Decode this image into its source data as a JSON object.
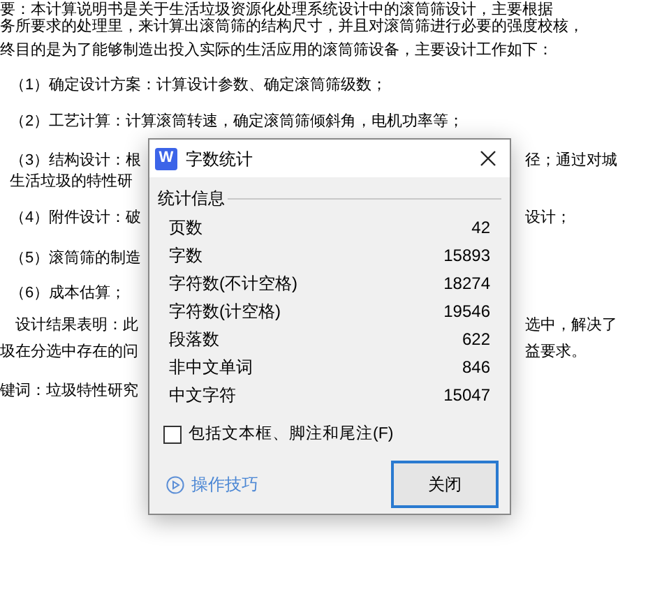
{
  "document": {
    "lines": [
      {
        "text": "要：本计算说明书是关于生活垃圾资源化处理系统设计中的滚筒筛设计，主要根据"
      },
      {
        "text": "务所要求的处理里，来计算出滚筒筛的结构尺寸，并且对滚筒筛进行必要的强度校核，"
      },
      {
        "text": "终目的是为了能够制造出投入实际的生活应用的滚筒筛设备，主要设计工作如下："
      },
      {
        "text": "（1）确定设计方案：计算设计参数、确定滚筒筛级数；"
      },
      {
        "text": "（2）工艺计算：计算滚筒转速，确定滚筒筛倾斜角，电机功率等；"
      },
      {
        "text": "（3）结构设计：根",
        "right": "径；通过对城"
      },
      {
        "text": "生活垃圾的特性研"
      },
      {
        "text": "（4）附件设计：破",
        "right": "设计；"
      },
      {
        "text": "（5）滚筒筛的制造"
      },
      {
        "text": "（6）成本估算；"
      },
      {
        "text": "设计结果表明：此",
        "right": "选中，解决了"
      },
      {
        "text": "圾在分选中存在的问",
        "right": "益要求。"
      },
      {
        "text": "键词：垃圾特性研究"
      }
    ]
  },
  "dialog": {
    "app_icon": "W",
    "title": "字数统计",
    "section": "统计信息",
    "stats": [
      {
        "label": "页数",
        "value": "42"
      },
      {
        "label": "字数",
        "value": "15893"
      },
      {
        "label": "字符数(不计空格)",
        "value": "18274"
      },
      {
        "label": "字符数(计空格)",
        "value": "19546"
      },
      {
        "label": "段落数",
        "value": "622"
      },
      {
        "label": "非中文单词",
        "value": "846"
      },
      {
        "label": "中文字符",
        "value": "15047"
      }
    ],
    "checkbox": {
      "label": "包括文本框、脚注和尾注(F)",
      "checked": false
    },
    "tips_link": "操作技巧",
    "close_button": "关闭"
  }
}
